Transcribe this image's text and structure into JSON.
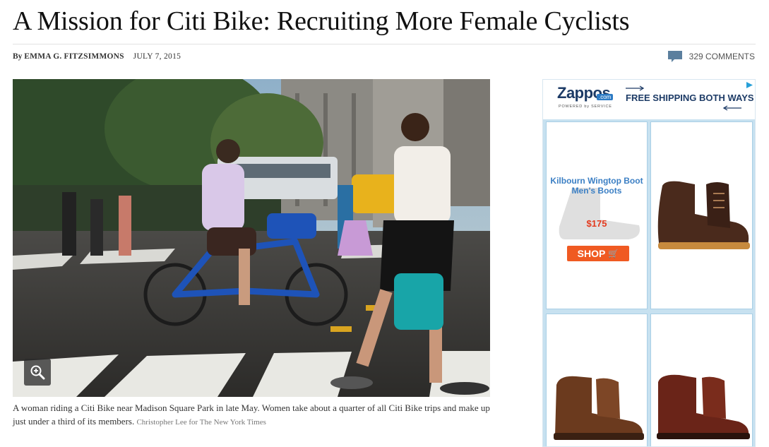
{
  "article": {
    "headline": "A Mission for Citi Bike: Recruiting More Female Cyclists",
    "byline_prefix": "By",
    "author": "EMMA G. FITZSIMMONS",
    "date": "JULY 7, 2015",
    "comments_label": "329 COMMENTS"
  },
  "photo": {
    "icon": "zoom-in-icon",
    "caption": "A woman riding a Citi Bike near Madison Square Park in late May. Women take about a quarter of all Citi Bike trips and make up just under a third of its members.",
    "credit": "Christopher Lee for The New York Times"
  },
  "ad": {
    "brand": "Zappos",
    "brand_suffix": ".com",
    "powered": "POWERED by SERVICE",
    "headline": "FREE SHIPPING BOTH WAYS",
    "product_name": "Kilbourn Wingtop Boot Men's Boots",
    "price": "$175",
    "shop_label": "SHOP",
    "colors": {
      "accent": "#f05a22",
      "link": "#3b7fc4",
      "price": "#e33a1e",
      "brand": "#1d3b66"
    }
  }
}
